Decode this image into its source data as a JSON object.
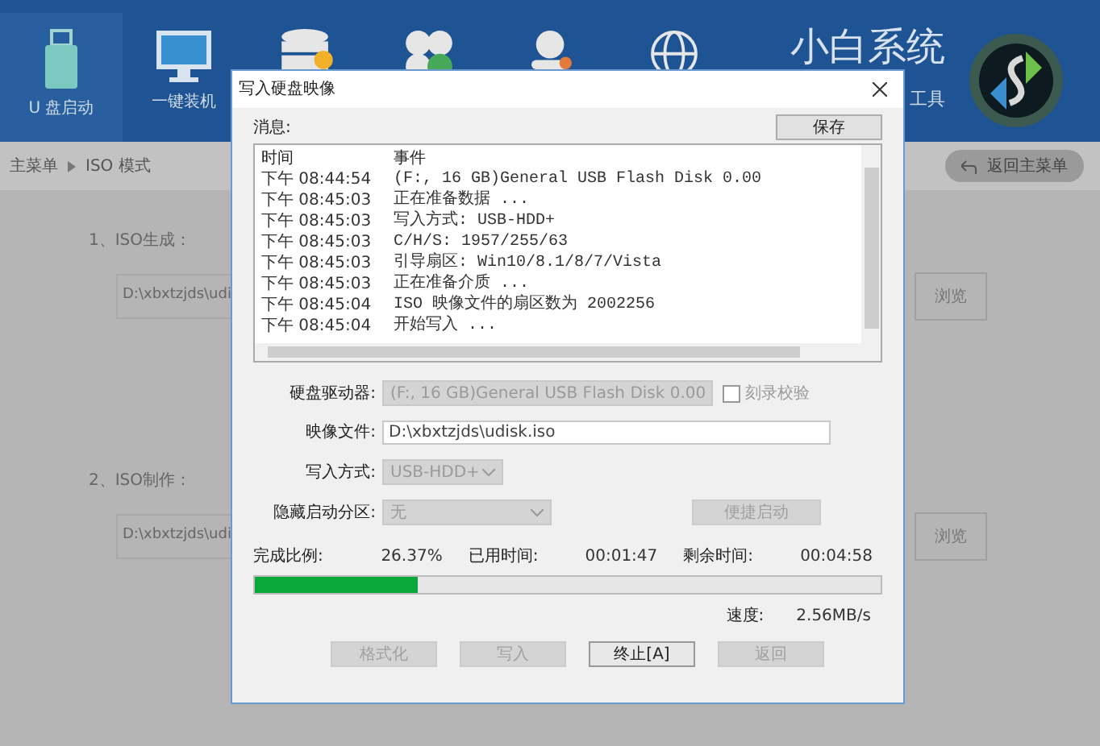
{
  "header": {
    "tiles": [
      {
        "kind": "usb",
        "label": "U 盘启动",
        "selected": true
      },
      {
        "kind": "monitor",
        "label": "一键装机",
        "selected": false
      },
      {
        "kind": "database",
        "selected": false
      },
      {
        "kind": "clover",
        "selected": false
      },
      {
        "kind": "person",
        "selected": false
      },
      {
        "kind": "globe",
        "selected": false
      }
    ],
    "brand": "小白系统",
    "brand_sub": "工具"
  },
  "breadcrumb": {
    "items": [
      "主菜单",
      "ISO 模式"
    ],
    "back_button": "返回主菜单"
  },
  "sections": [
    {
      "label": "1、ISO生成：",
      "path": "D:\\xbxtzjds\\udi",
      "button": "浏览"
    },
    {
      "label": "2、ISO制作：",
      "path": "D:\\xbxtzjds\\udi",
      "button": "浏览"
    }
  ],
  "dialog": {
    "title": "写入硬盘映像",
    "message_label": "消息:",
    "save_button": "保存",
    "log": {
      "columns": [
        "时间",
        "事件"
      ],
      "rows": [
        {
          "time": "下午 08:44:54",
          "event": "(F:, 16 GB)General USB Flash Disk  0.00"
        },
        {
          "time": "下午 08:45:03",
          "event": "正在准备数据 ..."
        },
        {
          "time": "下午 08:45:03",
          "event": "写入方式: USB-HDD+"
        },
        {
          "time": "下午 08:45:03",
          "event": "C/H/S: 1957/255/63"
        },
        {
          "time": "下午 08:45:03",
          "event": "引导扇区: Win10/8.1/8/7/Vista"
        },
        {
          "time": "下午 08:45:03",
          "event": "正在准备介质 ..."
        },
        {
          "time": "下午 08:45:04",
          "event": "ISO 映像文件的扇区数为 2002256"
        },
        {
          "time": "下午 08:45:04",
          "event": "开始写入 ..."
        }
      ]
    },
    "drive": {
      "label": "硬盘驱动器:",
      "value": "(F:, 16 GB)General USB Flash Disk  0.00",
      "disabled": true
    },
    "verify": {
      "label": "刻录校验",
      "checked": false
    },
    "image_file": {
      "label": "映像文件:",
      "value": "D:\\xbxtzjds\\udisk.iso"
    },
    "write_mode": {
      "label": "写入方式:",
      "value": "USB-HDD+",
      "disabled": true
    },
    "hidden_partition": {
      "label": "隐藏启动分区:",
      "value": "无",
      "disabled": true
    },
    "quick_boot": {
      "label": "便捷启动",
      "disabled": true
    },
    "stats": [
      {
        "label": "完成比例:",
        "value": "26.37%"
      },
      {
        "label": "已用时间:",
        "value": "00:01:47"
      },
      {
        "label": "剩余时间:",
        "value": "00:04:58"
      }
    ],
    "progress": {
      "level": 0.26
    },
    "speed": {
      "label": "速度:",
      "value": "2.56MB/s"
    },
    "buttons": [
      {
        "label": "格式化",
        "disabled": true
      },
      {
        "label": "写入",
        "disabled": true
      },
      {
        "label": "终止[A]",
        "disabled": false
      },
      {
        "label": "返回",
        "disabled": true
      }
    ]
  }
}
